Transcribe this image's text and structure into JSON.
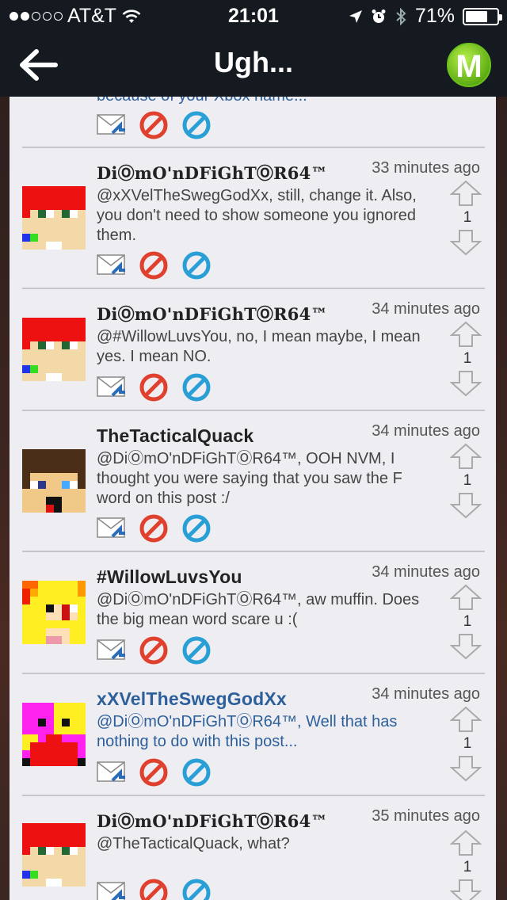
{
  "status_bar": {
    "carrier": "AT&T",
    "time": "21:01",
    "battery": "71%",
    "battery_level": 0.71
  },
  "nav": {
    "title": "Ugh...",
    "back_icon": "back-arrow-icon",
    "logo_letter": "M"
  },
  "partial_top": {
    "text": "because of your Xbox name..."
  },
  "comments": [
    {
      "username": "DiⓄmO'nDFiGhTⓄR64™",
      "time": "33 minutes ago",
      "text": "@xXVelTheSwegGodXx, still, change it. Also, you don't need to show someone you ignored them.",
      "votes": "1",
      "avatar": "red-hair-avatar"
    },
    {
      "username": "DiⓄmO'nDFiGhTⓄR64™",
      "time": "34 minutes ago",
      "text": "@#WillowLuvsYou, no, I mean maybe, I mean yes. I mean NO.",
      "votes": "1",
      "avatar": "red-hair-avatar"
    },
    {
      "username": "TheTacticalQuack",
      "time": "34 minutes ago",
      "text": "@DiⓄmO'nDFiGhTⓄR64™, OOH NVM, I thought you were saying that you saw the F word on this post :/",
      "votes": "1",
      "avatar": "brown-hair-avatar"
    },
    {
      "username": "#WillowLuvsYou",
      "time": "34 minutes ago",
      "text": "@DiⓄmO'nDFiGhTⓄR64™, aw muffin. Does the big mean word scare u :(",
      "votes": "1",
      "avatar": "blonde-avatar"
    },
    {
      "username": "xXVelTheSwegGodXx",
      "time": "34 minutes ago",
      "text": "@DiⓄmO'nDFiGhTⓄR64™, Well that has nothing to do with this post...",
      "votes": "1",
      "avatar": "pink-yellow-avatar"
    },
    {
      "username": "DiⓄmO'nDFiGhTⓄR64™",
      "time": "35 minutes ago",
      "text": "@TheTacticalQuack, what?",
      "votes": "1",
      "avatar": "red-hair-avatar"
    }
  ]
}
